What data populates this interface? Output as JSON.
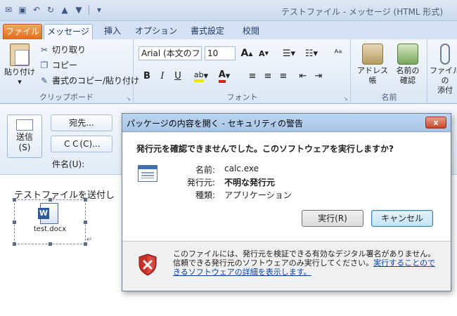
{
  "window": {
    "title": "テストファイル - メッセージ (HTML 形式)"
  },
  "ribbon": {
    "tabs": [
      {
        "label": "ファイル"
      },
      {
        "label": "メッセージ"
      },
      {
        "label": "挿入"
      },
      {
        "label": "オプション"
      },
      {
        "label": "書式設定"
      },
      {
        "label": "校閲"
      }
    ],
    "clipboard": {
      "paste": "貼り付け",
      "cut": "切り取り",
      "copy": "コピー",
      "format_painter": "書式のコピー/貼り付け",
      "group_label": "クリップボード"
    },
    "font": {
      "font_name": "Arial (本文のフ",
      "font_size": "10",
      "group_label": "フォント"
    },
    "names": {
      "address_book": "アドレス帳",
      "check_names_line1": "名前の",
      "check_names_line2": "確認",
      "group_label": "名前"
    },
    "attach": {
      "label_line1": "ファイルの",
      "label_line2": "添付"
    }
  },
  "compose": {
    "send_line1": "送信",
    "send_line2": "(S)",
    "to_button": "宛先...",
    "cc_button": "ＣＣ(C)...",
    "subject_label": "件名(U):",
    "body_text": "テストファイルを送付し",
    "attachment_name": "test.docx"
  },
  "dialog": {
    "title": "パッケージの内容を開く - セキュリティの警告",
    "close_label": "x",
    "question": "発行元を確認できませんでした。このソフトウェアを実行しますか?",
    "fields": {
      "name_label": "名前:",
      "name_value": "calc.exe",
      "publisher_label": "発行元:",
      "publisher_value": "不明な発行元",
      "type_label": "種類:",
      "type_value": "アプリケーション"
    },
    "run_button": "実行(R)",
    "cancel_button": "キャンセル",
    "warning_text": "このファイルには、発行元を検証できる有効なデジタル署名がありません。信頼できる発行元のソフトウェアのみ実行してください。",
    "warning_link": "実行することのできるソフトウェアの詳細を表示します。"
  }
}
